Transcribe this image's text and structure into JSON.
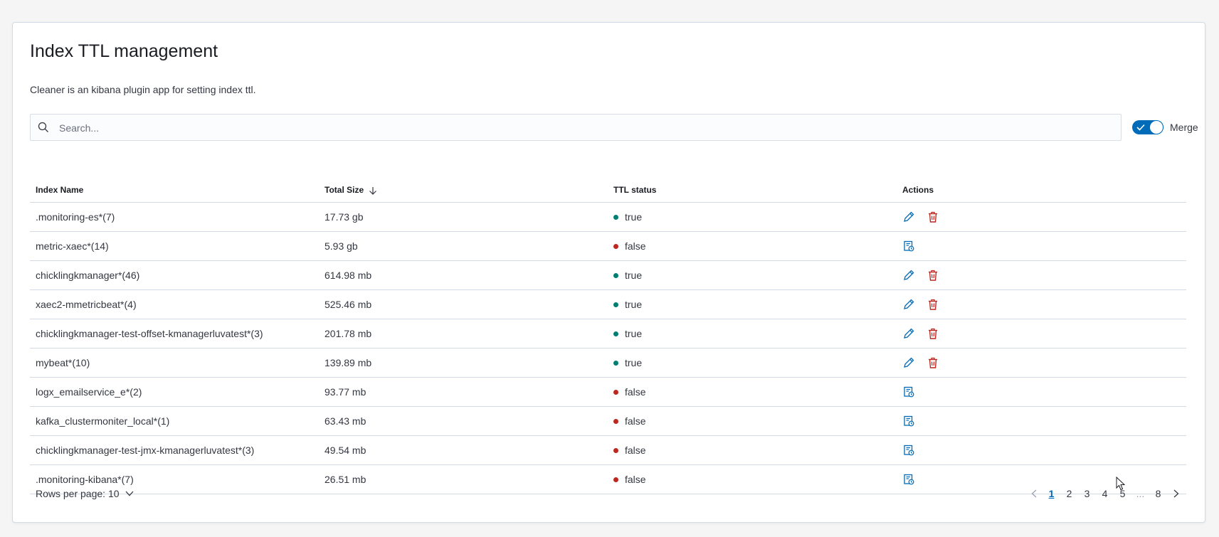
{
  "page": {
    "title": "Index TTL management",
    "description": "Cleaner is an kibana plugin app for setting index ttl."
  },
  "search": {
    "placeholder": "Search..."
  },
  "merge_toggle": {
    "label": "Merge",
    "checked": true
  },
  "table": {
    "headers": {
      "index_name": "Index Name",
      "total_size": "Total Size",
      "ttl_status": "TTL status",
      "actions": "Actions"
    },
    "sort": {
      "column": "Total Size",
      "direction": "descending"
    },
    "rows": [
      {
        "index_name": ".monitoring-es*(7)",
        "total_size": "17.73 gb",
        "ttl_status": "true",
        "actions": [
          "edit-icon",
          "delete-icon"
        ]
      },
      {
        "index_name": "metric-xaec*(14)",
        "total_size": "5.93 gb",
        "ttl_status": "false",
        "actions": [
          "add-ttl-icon"
        ]
      },
      {
        "index_name": "chicklingkmanager*(46)",
        "total_size": "614.98 mb",
        "ttl_status": "true",
        "actions": [
          "edit-icon",
          "delete-icon"
        ]
      },
      {
        "index_name": "xaec2-mmetricbeat*(4)",
        "total_size": "525.46 mb",
        "ttl_status": "true",
        "actions": [
          "edit-icon",
          "delete-icon"
        ]
      },
      {
        "index_name": "chicklingkmanager-test-offset-kmanagerluvatest*(3)",
        "total_size": "201.78 mb",
        "ttl_status": "true",
        "actions": [
          "edit-icon",
          "delete-icon"
        ]
      },
      {
        "index_name": "mybeat*(10)",
        "total_size": "139.89 mb",
        "ttl_status": "true",
        "actions": [
          "edit-icon",
          "delete-icon"
        ]
      },
      {
        "index_name": "logx_emailservice_e*(2)",
        "total_size": "93.77 mb",
        "ttl_status": "false",
        "actions": [
          "add-ttl-icon"
        ]
      },
      {
        "index_name": "kafka_clustermoniter_local*(1)",
        "total_size": "63.43 mb",
        "ttl_status": "false",
        "actions": [
          "add-ttl-icon"
        ]
      },
      {
        "index_name": "chicklingkmanager-test-jmx-kmanagerluvatest*(3)",
        "total_size": "49.54 mb",
        "ttl_status": "false",
        "actions": [
          "add-ttl-icon"
        ]
      },
      {
        "index_name": ".monitoring-kibana*(7)",
        "total_size": "26.51 mb",
        "ttl_status": "false",
        "actions": [
          "add-ttl-icon"
        ]
      }
    ]
  },
  "footer": {
    "rows_per_page": "Rows per page: 10",
    "pagination": {
      "pages": [
        "1",
        "2",
        "3",
        "4",
        "5"
      ],
      "ellipsis": "...",
      "last_page": "8",
      "current": "1"
    }
  },
  "colors": {
    "accent": "#006bb8",
    "status_true": "#017d73",
    "status_false": "#bd271e",
    "delete": "#bd271e"
  }
}
